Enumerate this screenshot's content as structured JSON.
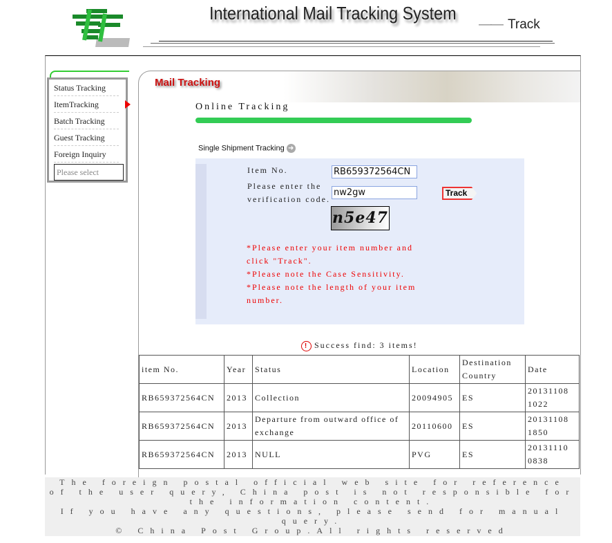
{
  "header": {
    "title": "International Mail Tracking System",
    "section": "Track",
    "section_prefix": "——"
  },
  "sidebar": {
    "items": [
      {
        "label": "Status Tracking"
      },
      {
        "label": "ItemTracking"
      },
      {
        "label": "Batch Tracking"
      },
      {
        "label": "Guest Tracking"
      },
      {
        "label": "Foreign Inquiry"
      }
    ],
    "select_placeholder": "Please select"
  },
  "main": {
    "banner_title": "Mail Tracking",
    "heading": "Online Tracking",
    "sub_heading": "Single Shipment Tracking",
    "form": {
      "item_label": "Item No.",
      "item_value": "RB659372564CN",
      "code_label": "Please enter the verification code.",
      "code_value": "nw2gw",
      "captcha_text": "n5e47",
      "track_label": "Track"
    },
    "notes": [
      "*Please enter your item number and click \"Track\".",
      "*Please note the Case Sensitivity.",
      "*Please note the length of your item number."
    ],
    "success": "Success find: 3 items!"
  },
  "table": {
    "headers": [
      "item No.",
      "Year",
      "Status",
      "Location",
      "Destination Country",
      "Date"
    ],
    "rows": [
      [
        "RB659372564CN",
        "2013",
        "Collection",
        "20094905",
        "ES",
        "20131108 1022"
      ],
      [
        "RB659372564CN",
        "2013",
        "Departure from outward office of exchange",
        "20110600",
        "ES",
        "20131108 1850"
      ],
      [
        "RB659372564CN",
        "2013",
        "NULL",
        "PVG",
        "ES",
        "20131110 0838"
      ]
    ]
  },
  "footer": {
    "lines": [
      "The foreign postal official web site for reference of the user query, China post is not responsible for the information content.",
      "If you have any questions, please send for manual query.",
      "© China Post Group.All rights reserved"
    ]
  },
  "colors": {
    "accent_green": "#33cc55",
    "accent_red": "#ee0000",
    "form_bg": "#e6ecfa"
  }
}
